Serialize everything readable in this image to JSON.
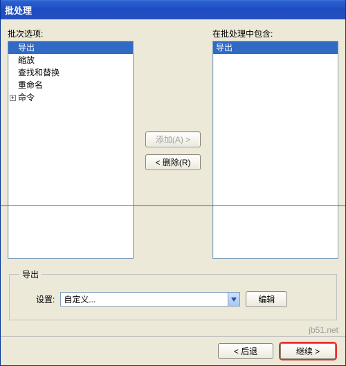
{
  "window": {
    "title": "批处理"
  },
  "labels": {
    "left_list": "批次选项:",
    "right_list": "在批处理中包含:"
  },
  "left_options": {
    "items": [
      {
        "label": "导出",
        "selected": true
      },
      {
        "label": "缩放",
        "selected": false
      },
      {
        "label": "查找和替换",
        "selected": false
      },
      {
        "label": "重命名",
        "selected": false
      }
    ],
    "tree_parent": "命令"
  },
  "right_included": {
    "items": [
      {
        "label": "导出",
        "selected": true
      }
    ]
  },
  "mid_buttons": {
    "add": "添加(A) >",
    "remove": "< 删除(R)"
  },
  "export_group": {
    "legend": "导出",
    "settings_label": "设置:",
    "combo_value": "自定义...",
    "edit_button": "编辑"
  },
  "footer": {
    "back": "< 后退",
    "next": "继续 >"
  },
  "watermark": "jb51.net"
}
